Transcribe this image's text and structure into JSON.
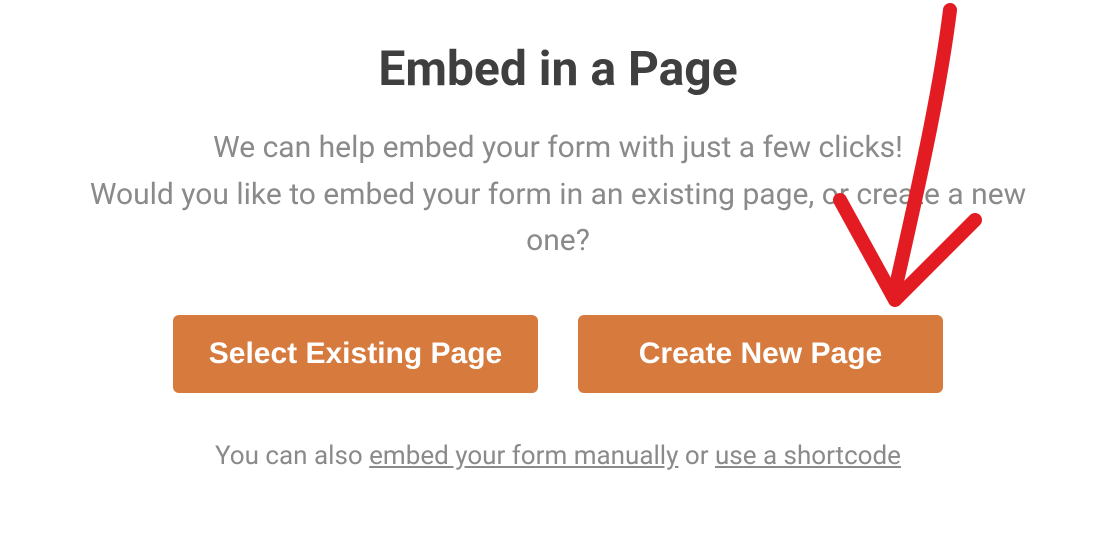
{
  "modal": {
    "title": "Embed in a Page",
    "description_line1": "We can help embed your form with just a few clicks!",
    "description_line2": "Would you like to embed your form in an existing page, or create a new one?",
    "buttons": {
      "select_existing": "Select Existing Page",
      "create_new": "Create New Page"
    },
    "footer": {
      "prefix": "You can also ",
      "link_manual": "embed your form manually",
      "mid": " or ",
      "link_shortcode": "use a shortcode"
    }
  },
  "colors": {
    "accent": "#d67a3e",
    "title": "#3f3f3f",
    "muted": "#8a8a8a",
    "annotation": "#e31b23"
  }
}
